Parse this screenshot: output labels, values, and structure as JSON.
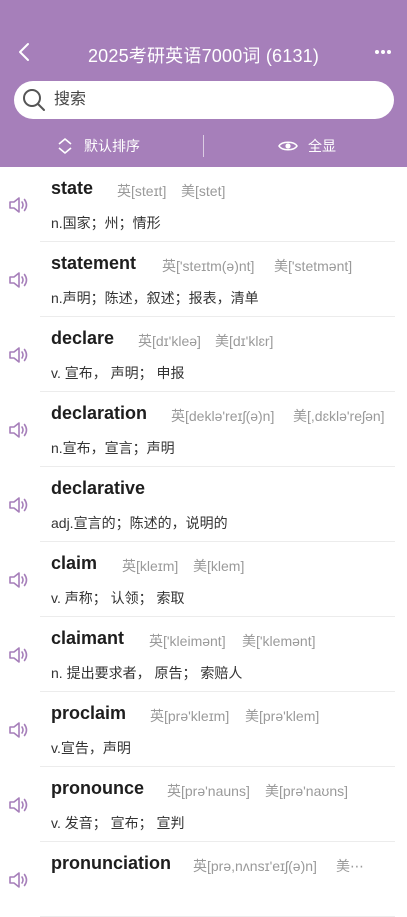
{
  "header": {
    "title": "2025考研英语7000词 (6131)",
    "search_placeholder": "搜索",
    "sort_label": "默认排序",
    "show_all_label": "全显",
    "colors": {
      "accent": "#a67fba"
    }
  },
  "words": [
    {
      "word": "state",
      "uk": "英[steɪt]",
      "us": "美[stet]",
      "meaning": "n.国家；州；情形"
    },
    {
      "word": "statement",
      "uk": "英['steɪtm(ə)nt]",
      "us": "美['stetmənt]",
      "meaning": "n.声明；陈述，叙述；报表，清单"
    },
    {
      "word": "declare",
      "uk": "英[dɪ'kleə]",
      "us": "美[dɪ'klɛr]",
      "meaning": "v. 宣布， 声明； 申报"
    },
    {
      "word": "declaration",
      "uk": "英[deklə'reɪʃ(ə)n]",
      "us": "美[,dɛklə'reʃən]",
      "meaning": "n.宣布，宣言；声明"
    },
    {
      "word": "declarative",
      "uk": "",
      "us": "",
      "meaning": "adj.宣言的；陈述的，说明的"
    },
    {
      "word": "claim",
      "uk": "英[kleɪm]",
      "us": "美[klem]",
      "meaning": "v. 声称； 认领； 索取"
    },
    {
      "word": "claimant",
      "uk": "英['kleimənt]",
      "us": "美['klemənt]",
      "meaning": "n. 提出要求者， 原告； 索赔人"
    },
    {
      "word": "proclaim",
      "uk": "英[prə'kleɪm]",
      "us": "美[prə'klem]",
      "meaning": "v.宣告，声明"
    },
    {
      "word": "pronounce",
      "uk": "英[prə'nauns]",
      "us": "美[prə'naʊns]",
      "meaning": "v. 发音； 宣布； 宣判"
    },
    {
      "word": "pronunciation",
      "uk": "英[prə,nʌnsɪ'eɪʃ(ə)n]",
      "us": "美⋯",
      "meaning": ""
    }
  ]
}
